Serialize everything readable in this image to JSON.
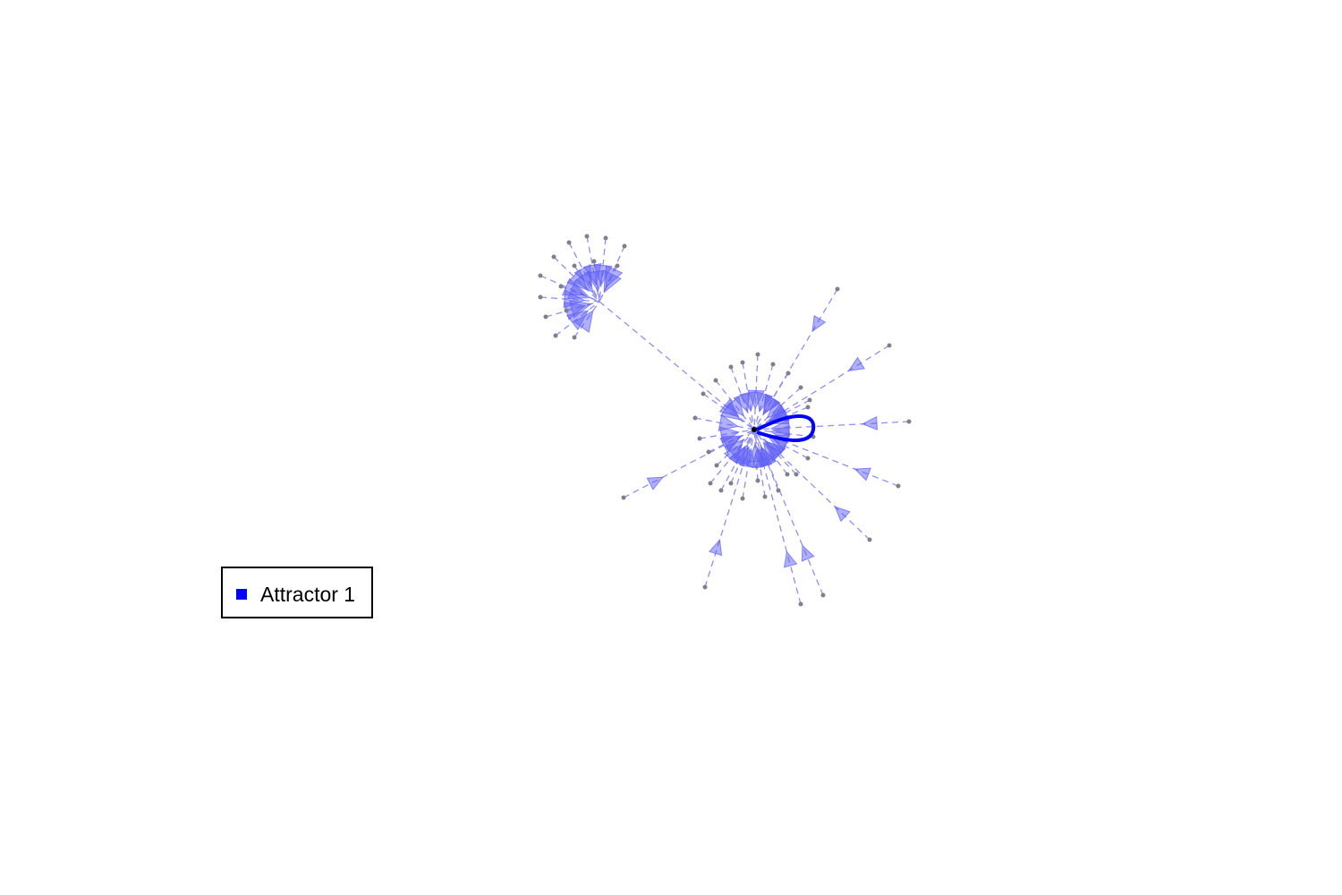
{
  "colors": {
    "attractor": "#0000ff",
    "edge": "#8f8fef",
    "arrow": "#6060f5",
    "state_node": "#80808a",
    "attractor_node": "#000000"
  },
  "legend": {
    "items": [
      {
        "label": "Attractor 1",
        "color": "#0000ff"
      }
    ]
  }
}
